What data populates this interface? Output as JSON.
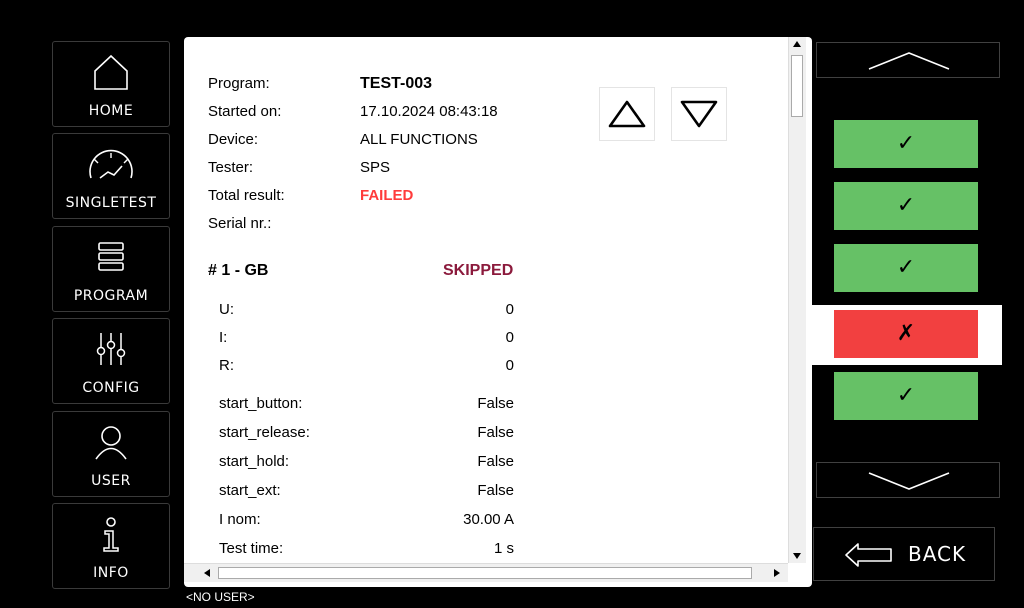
{
  "nav": {
    "home": "HOME",
    "singletest": "SINGLETEST",
    "program": "PROGRAM",
    "config": "CONFIG",
    "user": "USER",
    "info": "INFO"
  },
  "report": {
    "header": [
      {
        "label": "Program:",
        "value": "TEST-003"
      },
      {
        "label": "Started on:",
        "value": "17.10.2024 08:43:18"
      },
      {
        "label": "Device:",
        "value": "ALL FUNCTIONS"
      },
      {
        "label": "Tester:",
        "value": "SPS"
      },
      {
        "label": "Total result:",
        "value": "FAILED"
      },
      {
        "label": "Serial nr.:",
        "value": ""
      }
    ],
    "step": {
      "title": "# 1 - GB",
      "status": "SKIPPED"
    },
    "measurements": [
      {
        "label": "U:",
        "value": "0"
      },
      {
        "label": "I:",
        "value": "0"
      },
      {
        "label": "R:",
        "value": "0"
      }
    ],
    "params": [
      {
        "label": "start_button:",
        "value": "False"
      },
      {
        "label": "start_release:",
        "value": "False"
      },
      {
        "label": "start_hold:",
        "value": "False"
      },
      {
        "label": "start_ext:",
        "value": "False"
      },
      {
        "label": "I nom:",
        "value": "30.00 A"
      },
      {
        "label": "Test time:",
        "value": "1 s"
      }
    ]
  },
  "results": [
    {
      "symbol": "✓",
      "status": "pass"
    },
    {
      "symbol": "✓",
      "status": "pass"
    },
    {
      "symbol": "✓",
      "status": "pass"
    },
    {
      "symbol": "✗",
      "status": "fail"
    },
    {
      "symbol": "✓",
      "status": "pass"
    }
  ],
  "back_label": "BACK",
  "user_status": "<NO USER>",
  "colors": {
    "pass": "#66c166",
    "fail": "#f24040",
    "failed_text": "#ff3b3b",
    "skipped_text": "#8b1a3c"
  }
}
